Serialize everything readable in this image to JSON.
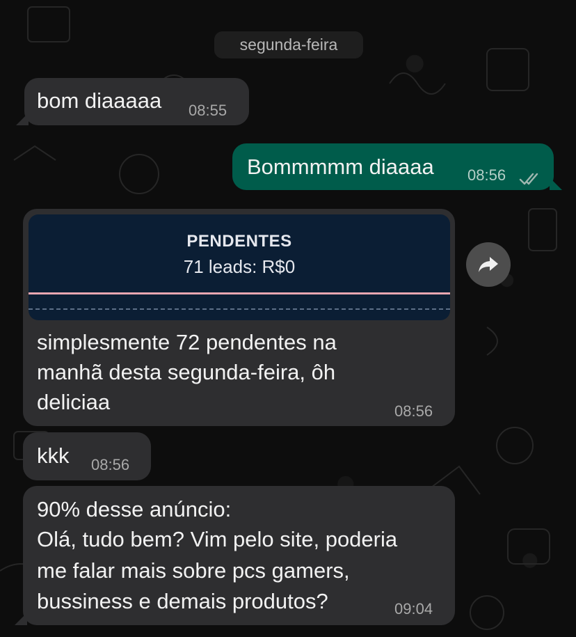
{
  "chat": {
    "date_separator": "segunda-feira",
    "messages": [
      {
        "direction": "in",
        "text": "bom diaaaaa",
        "time": "08:55"
      },
      {
        "direction": "out",
        "text": "Bommmmm diaaaa",
        "time": "08:56",
        "status": "read-double-check-icon"
      },
      {
        "direction": "in",
        "attachment": {
          "title": "PENDENTES",
          "subtitle": "71 leads: R$0"
        },
        "text_lines": [
          "simplesmente 72 pendentes na",
          "manhã desta segunda-feira, ôh",
          "deliciaa"
        ],
        "time": "08:56"
      },
      {
        "direction": "in",
        "text": "kkk",
        "time": "08:56"
      },
      {
        "direction": "in",
        "text_lines": [
          "90% desse anúncio:",
          "Olá, tudo bem? Vim pelo site, poderia",
          "me falar mais sobre pcs gamers,",
          "bussiness e demais produtos?"
        ],
        "time": "09:04"
      }
    ]
  },
  "icons": {
    "forward": "forward-arrow-icon",
    "read_receipt": "double-check-icon"
  },
  "colors": {
    "incoming_bubble": "#2e2e30",
    "outgoing_bubble": "#005c4b",
    "background": "#0d0d0d"
  }
}
